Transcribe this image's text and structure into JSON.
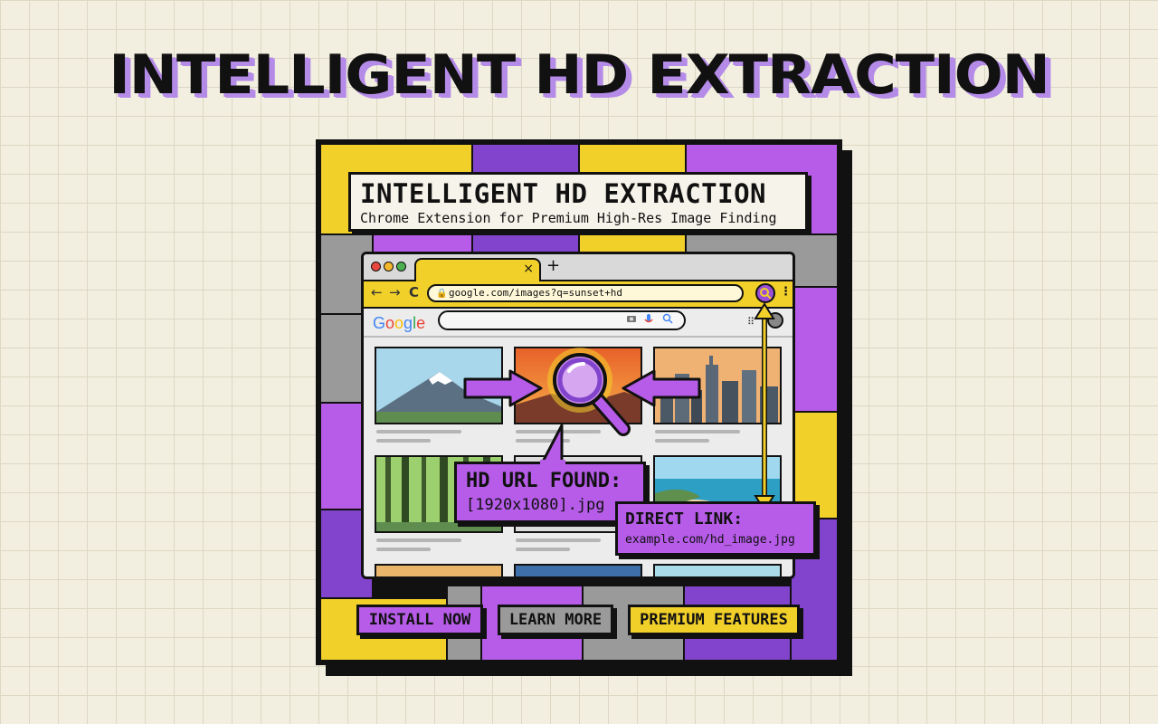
{
  "headline": "INTELLIGENT HD EXTRACTION",
  "card": {
    "title": "INTELLIGENT HD EXTRACTION",
    "subtitle": "Chrome Extension for Premium High-Res Image Finding"
  },
  "browser": {
    "tab_close": "×",
    "new_tab": "+",
    "nav_back": "←",
    "nav_forward": "→",
    "nav_reload": "C",
    "url": "google.com/images?q=sunset+hd",
    "logo": [
      "G",
      "o",
      "o",
      "g",
      "l",
      "e"
    ],
    "logo_colors": [
      "#4285F4",
      "#EA4335",
      "#FBBC05",
      "#4285F4",
      "#34A853",
      "#EA4335"
    ],
    "extension_icon": "magnifier-badge-icon"
  },
  "callouts": {
    "hd_found_title": "HD URL FOUND:",
    "hd_found_value": "[1920x1080].jpg",
    "direct_link_title": "DIRECT LINK:",
    "direct_link_value": "example.com/hd_image.jpg"
  },
  "buttons": {
    "install": "INSTALL NOW",
    "learn": "LEARN MORE",
    "premium": "PREMIUM FEATURES"
  },
  "colors": {
    "yellow": "#f2d02a",
    "purple": "#b65ce8",
    "dark_purple": "#8244cc",
    "gray": "#9a9a9a"
  }
}
